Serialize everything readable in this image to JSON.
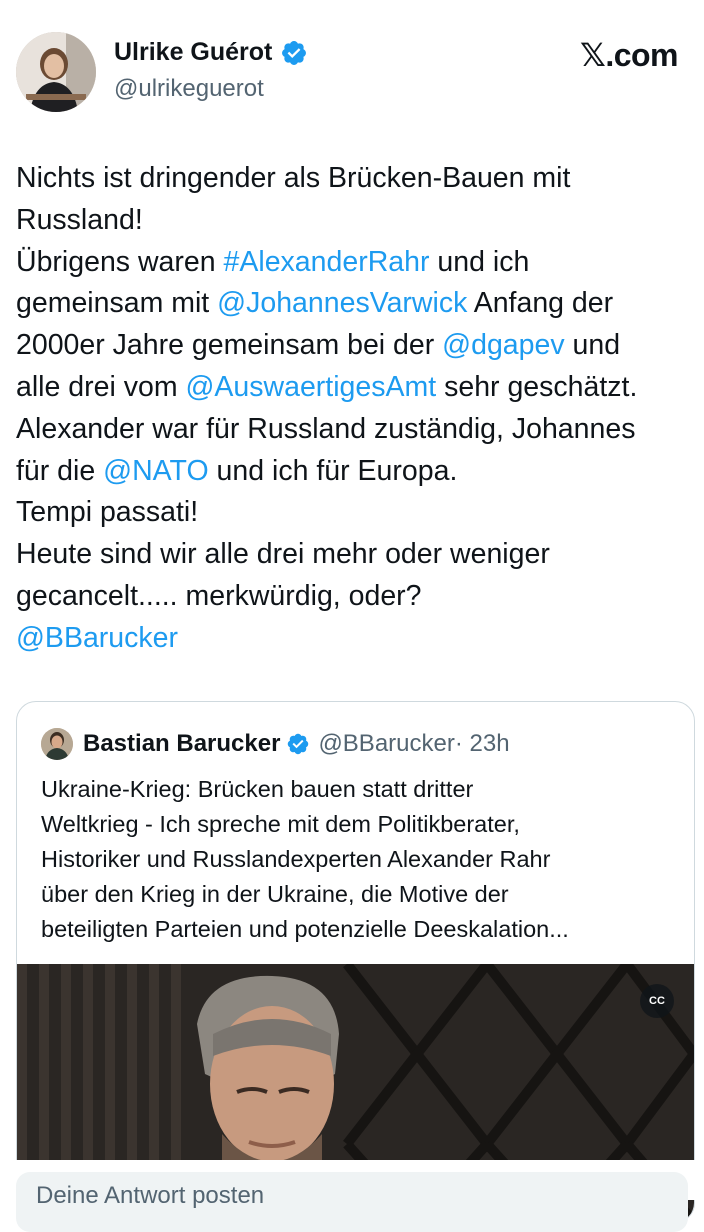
{
  "author": {
    "name": "Ulrike Guérot",
    "handle": "@ulrikeguerot",
    "verified_icon": "verified-badge-icon"
  },
  "brand": {
    "label": "𝕏.com"
  },
  "tweet": {
    "lines": [
      [
        {
          "t": "Nichts ist dringender als Brücken-Bauen mit",
          "link": false
        }
      ],
      [
        {
          "t": "Russland!",
          "link": false
        }
      ],
      [
        {
          "t": "Übrigens waren ",
          "link": false
        },
        {
          "t": "#AlexanderRahr",
          "link": true
        },
        {
          "t": " und ich",
          "link": false
        }
      ],
      [
        {
          "t": "gemeinsam mit ",
          "link": false
        },
        {
          "t": "@JohannesVarwick",
          "link": true
        },
        {
          "t": " Anfang der",
          "link": false
        }
      ],
      [
        {
          "t": "2000er Jahre gemeinsam bei der ",
          "link": false
        },
        {
          "t": "@dgapev",
          "link": true
        },
        {
          "t": " und",
          "link": false
        }
      ],
      [
        {
          "t": "alle drei vom ",
          "link": false
        },
        {
          "t": "@AuswaertigesAmt",
          "link": true
        },
        {
          "t": " sehr geschätzt.",
          "link": false
        }
      ],
      [
        {
          "t": "Alexander war für Russland zuständig, Johannes",
          "link": false
        }
      ],
      [
        {
          "t": "für die ",
          "link": false
        },
        {
          "t": "@NATO",
          "link": true
        },
        {
          "t": " und ich für Europa.",
          "link": false
        }
      ],
      [
        {
          "t": "Tempi passati!",
          "link": false
        }
      ],
      [
        {
          "t": "Heute sind wir alle drei mehr oder weniger",
          "link": false
        }
      ],
      [
        {
          "t": "gecancelt..... merkwürdig, oder?",
          "link": false
        }
      ],
      [
        {
          "t": "@BBarucker",
          "link": true
        }
      ]
    ]
  },
  "quote": {
    "name": "Bastian Barucker",
    "handle": "@BBarucker",
    "time": " · 23h",
    "lines": [
      "Ukraine-Krieg: Brücken bauen statt dritter",
      "Weltkrieg - Ich spreche mit dem Politikberater,",
      "Historiker und Russlandexperten Alexander Rahr",
      "über den Krieg in der Ukraine, die Motive der",
      "beteiligten Parteien und potenzielle Deeskalation..."
    ],
    "cc_label": "CC"
  },
  "reply": {
    "placeholder": "Deine Antwort posten"
  },
  "colors": {
    "link": "#1d9bf0",
    "verified": "#1d9bf0",
    "secondary": "#536471",
    "border": "#cfd9de"
  }
}
